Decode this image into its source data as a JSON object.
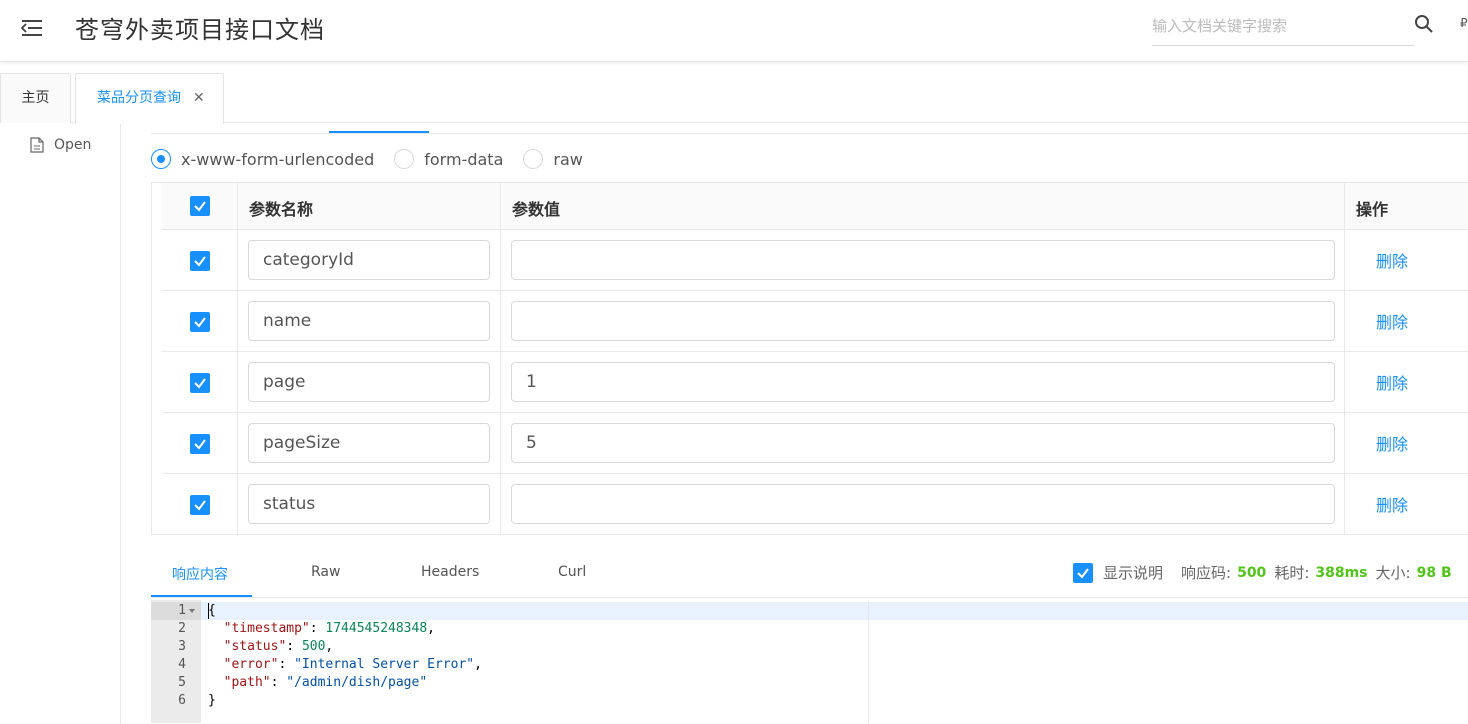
{
  "header": {
    "title": "苍穹外卖项目接口文档",
    "search_placeholder": "输入文档关键字搜索",
    "extra": "₽"
  },
  "tabs": [
    {
      "label": "主页"
    },
    {
      "label": "菜品分页查询"
    }
  ],
  "sidebar": {
    "open_label": "Open"
  },
  "body_types": [
    {
      "label": "x-www-form-urlencoded",
      "selected": true
    },
    {
      "label": "form-data",
      "selected": false
    },
    {
      "label": "raw",
      "selected": false
    }
  ],
  "params": {
    "headers": {
      "name": "参数名称",
      "value": "参数值",
      "op": "操作"
    },
    "delete_label": "删除",
    "rows": [
      {
        "name": "categoryId",
        "value": "",
        "checked": true
      },
      {
        "name": "name",
        "value": "",
        "checked": true
      },
      {
        "name": "page",
        "value": "1",
        "checked": true
      },
      {
        "name": "pageSize",
        "value": "5",
        "checked": true
      },
      {
        "name": "status",
        "value": "",
        "checked": true
      }
    ]
  },
  "response": {
    "tabs": [
      "响应内容",
      "Raw",
      "Headers",
      "Curl"
    ],
    "show_desc_label": "显示说明",
    "code_label": "响应码:",
    "code_value": "500",
    "time_label": "耗时:",
    "time_value": "388ms",
    "size_label": "大小:",
    "size_value": "98 B"
  },
  "code": {
    "line_numbers": [
      "1",
      "2",
      "3",
      "4",
      "5",
      "6"
    ],
    "timestamp_key": "\"timestamp\"",
    "timestamp_val": "1744545248348",
    "status_key": "\"status\"",
    "status_val": "500",
    "error_key": "\"error\"",
    "error_val": "\"Internal Server Error\"",
    "path_key": "\"path\"",
    "path_val": "\"/admin/dish/page\"",
    "open_brace": "{",
    "close_brace": "}"
  },
  "colors": {
    "accent": "#1890ff",
    "success": "#52c41a"
  }
}
